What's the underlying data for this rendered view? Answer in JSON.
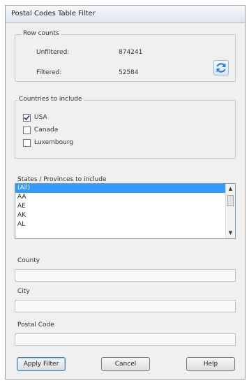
{
  "window": {
    "title": "Postal Codes Table Filter"
  },
  "row_counts": {
    "legend": "Row counts",
    "unfiltered_label": "Unfiltered:",
    "unfiltered_value": "874241",
    "filtered_label": "Filtered:",
    "filtered_value": "52584",
    "refresh_icon": "refresh-icon",
    "accent": "#2f7fd6"
  },
  "countries": {
    "legend": "Countries to include",
    "items": [
      {
        "label": "USA",
        "checked": true
      },
      {
        "label": "Canada",
        "checked": false
      },
      {
        "label": "Luxembourg",
        "checked": false
      }
    ]
  },
  "states": {
    "label": "States / Provinces to include",
    "items": [
      "(All)",
      "AA",
      "AE",
      "AK",
      "AL"
    ],
    "selected_index": 0,
    "selection_color": "#3399ff"
  },
  "county": {
    "label": "County",
    "value": ""
  },
  "city": {
    "label": "City",
    "value": ""
  },
  "postal_code": {
    "label": "Postal Code",
    "value": ""
  },
  "buttons": {
    "apply": "Apply Filter",
    "cancel": "Cancel",
    "help": "Help"
  }
}
